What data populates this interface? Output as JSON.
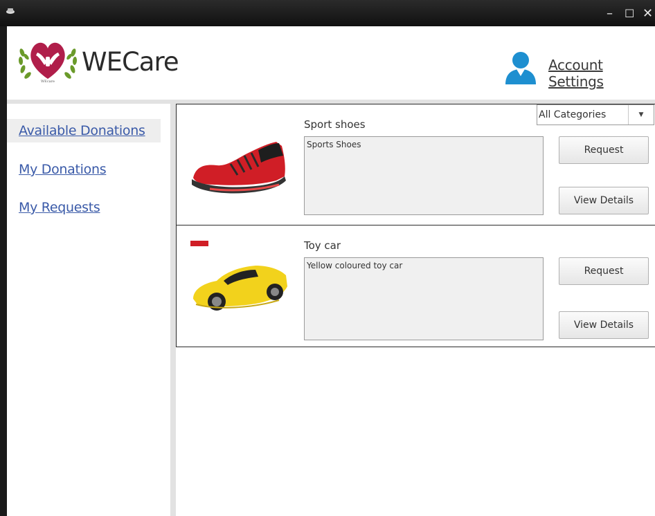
{
  "window": {
    "controls": {
      "minimize": "–",
      "maximize": "☐",
      "close": "✕"
    }
  },
  "header": {
    "brand": "WECare",
    "account_settings": "Account Settings",
    "logo_small_text": "WEcare"
  },
  "sidebar": {
    "items": [
      {
        "label": "Available Donations",
        "active": true
      },
      {
        "label": "My Donations",
        "active": false
      },
      {
        "label": "My Requests",
        "active": false
      }
    ]
  },
  "filter": {
    "selected": "All Categories"
  },
  "donations": [
    {
      "title": "Sport shoes",
      "description": "Sports Shoes",
      "request_label": "Request",
      "details_label": "View Details",
      "image": "red-sport-shoe"
    },
    {
      "title": "Toy car",
      "description": "Yellow coloured toy car",
      "request_label": "Request",
      "details_label": "View Details",
      "image": "yellow-toy-car"
    }
  ],
  "colors": {
    "titlebar": "#1a1a1a",
    "link": "#3a5aa8",
    "heart": "#b01e4a",
    "laurel": "#6a9a2a",
    "user_icon": "#1e8fd0"
  }
}
